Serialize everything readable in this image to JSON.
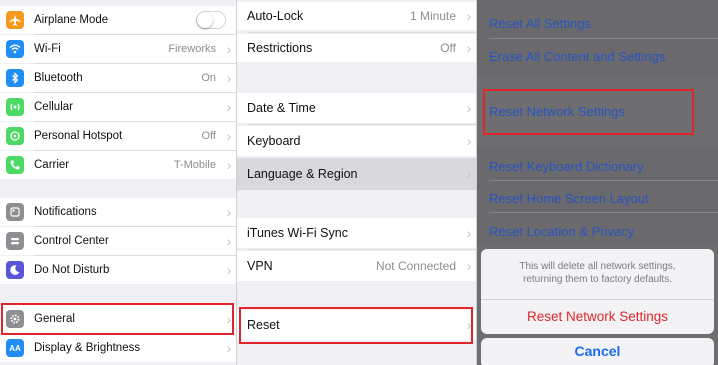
{
  "panel_settings": {
    "group1": [
      {
        "label": "Airplane Mode",
        "value": "",
        "icon": "airplane-icon",
        "color": "#f39a1f",
        "toggle": true
      },
      {
        "label": "Wi-Fi",
        "value": "Fireworks",
        "icon": "wifi-icon",
        "color": "#1f8df3"
      },
      {
        "label": "Bluetooth",
        "value": "On",
        "icon": "bluetooth-icon",
        "color": "#1f8df3"
      },
      {
        "label": "Cellular",
        "value": "",
        "icon": "cellular-icon",
        "color": "#4cd964"
      },
      {
        "label": "Personal Hotspot",
        "value": "Off",
        "icon": "hotspot-icon",
        "color": "#4cd964"
      },
      {
        "label": "Carrier",
        "value": "T-Mobile",
        "icon": "phone-icon",
        "color": "#4cd964"
      }
    ],
    "group2": [
      {
        "label": "Notifications",
        "icon": "notifications-icon",
        "color": "#8e8e93"
      },
      {
        "label": "Control Center",
        "icon": "control-center-icon",
        "color": "#8e8e93"
      },
      {
        "label": "Do Not Disturb",
        "icon": "moon-icon",
        "color": "#5856d6"
      }
    ],
    "group3": [
      {
        "label": "General",
        "icon": "gear-icon",
        "color": "#8e8e93"
      },
      {
        "label": "Display & Brightness",
        "icon": "display-icon",
        "color": "#1f8df3",
        "icon_text": "AA"
      }
    ]
  },
  "panel_general": {
    "group1": [
      {
        "label": "Auto-Lock",
        "value": "1 Minute"
      },
      {
        "label": "Restrictions",
        "value": "Off"
      }
    ],
    "group2": [
      {
        "label": "Date & Time",
        "value": ""
      },
      {
        "label": "Keyboard",
        "value": ""
      },
      {
        "label": "Language & Region",
        "value": ""
      }
    ],
    "group3": [
      {
        "label": "iTunes Wi-Fi Sync",
        "value": ""
      },
      {
        "label": "VPN",
        "value": "Not Connected"
      }
    ],
    "group4": [
      {
        "label": "Reset",
        "value": ""
      }
    ]
  },
  "panel_reset": {
    "items": [
      "Reset All Settings",
      "Erase All Content and Settings",
      "Reset Network Settings",
      "Reset Keyboard Dictionary",
      "Reset Home Screen Layout",
      "Reset Location & Privacy"
    ],
    "sheet": {
      "message": "This will delete all network settings, returning them to factory defaults.",
      "confirm_label": "Reset Network Settings",
      "cancel_label": "Cancel"
    }
  },
  "chevron": "›",
  "colors": {
    "highlight": "#e0262a",
    "link": "#2a53c4",
    "destructive": "#e0262a",
    "cancel": "#1a6bf0"
  }
}
